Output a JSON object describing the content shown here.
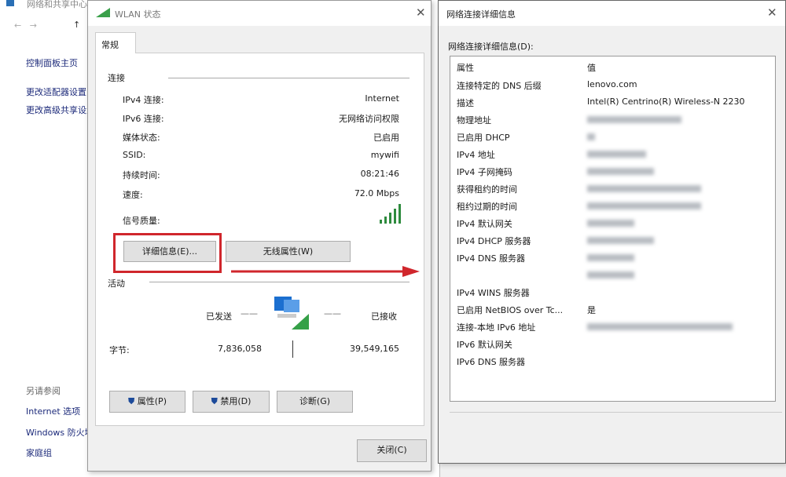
{
  "background_window": {
    "title": "网络和共享中心",
    "nav": [
      "控制面板主页",
      "更改适配器设置",
      "更改高级共享设置"
    ],
    "see_also": "另请参阅",
    "see_also_items": [
      "Internet 选项",
      "Windows 防火墙",
      "家庭组"
    ]
  },
  "wlan_status": {
    "title": "WLAN 状态",
    "tab": "常规",
    "connection_heading": "连接",
    "rows": [
      {
        "label": "IPv4 连接:",
        "value": "Internet"
      },
      {
        "label": "IPv6 连接:",
        "value": "无网络访问权限"
      },
      {
        "label": "媒体状态:",
        "value": "已启用"
      },
      {
        "label": "SSID:",
        "value": "mywifi"
      },
      {
        "label": "持续时间:",
        "value": "08:21:46"
      },
      {
        "label": "速度:",
        "value": "72.0 Mbps"
      }
    ],
    "signal_label": "信号质量:",
    "signal_bars": 5,
    "details_button": "详细信息(E)...",
    "wireless_button": "无线属性(W)",
    "activity_heading": "活动",
    "sent_label": "已发送",
    "received_label": "已接收",
    "bytes_label": "字节:",
    "bytes_sent": "7,836,058",
    "bytes_received": "39,549,165",
    "properties_button": "属性(P)",
    "disable_button": "禁用(D)",
    "diagnose_button": "诊断(G)",
    "close_button": "关闭(C)",
    "highlight_color": "#d0262c"
  },
  "details_window": {
    "title": "网络连接详细信息",
    "list_label": "网络连接详细信息(D):",
    "header": {
      "property": "属性",
      "value": "值"
    },
    "rows": [
      {
        "k": "连接特定的 DNS 后缀",
        "v": "lenovo.com"
      },
      {
        "k": "描述",
        "v": "Intel(R) Centrino(R) Wireless-N 2230"
      },
      {
        "k": "物理地址",
        "v": ""
      },
      {
        "k": "已启用 DHCP",
        "v": ""
      },
      {
        "k": "IPv4 地址",
        "v": ""
      },
      {
        "k": "IPv4 子网掩码",
        "v": ""
      },
      {
        "k": "获得租约的时间",
        "v": ""
      },
      {
        "k": "租约过期的时间",
        "v": ""
      },
      {
        "k": "IPv4 默认网关",
        "v": ""
      },
      {
        "k": "IPv4 DHCP 服务器",
        "v": ""
      },
      {
        "k": "IPv4 DNS 服务器",
        "v": ""
      },
      {
        "k": "",
        "v": ""
      },
      {
        "k": "IPv4 WINS 服务器",
        "v": ""
      },
      {
        "k": "已启用 NetBIOS over Tc...",
        "v": "是"
      },
      {
        "k": "连接-本地 IPv6 地址",
        "v": ""
      },
      {
        "k": "IPv6 默认网关",
        "v": ""
      },
      {
        "k": "IPv6 DNS 服务器",
        "v": ""
      }
    ]
  }
}
